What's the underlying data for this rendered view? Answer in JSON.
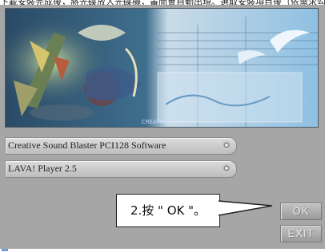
{
  "top_caption": "下載安裝完成後，將光碟放入光碟機，畫面會自動出現。選取安裝項目後（依需求勾選）",
  "banner": {
    "logo_text": "CREATIVE"
  },
  "components": [
    {
      "label": "Creative Sound Blaster PCI128 Software",
      "icon": "disc-icon"
    },
    {
      "label": "LAVA! Player 2.5",
      "icon": "disc-icon"
    }
  ],
  "buttons": {
    "ok": "OK",
    "exit": "EXIT"
  },
  "callout": {
    "text": "2.按 \" OK \"。"
  },
  "colors": {
    "panel": "#a6a6a6",
    "accent_blue": "#7fb2d8"
  }
}
